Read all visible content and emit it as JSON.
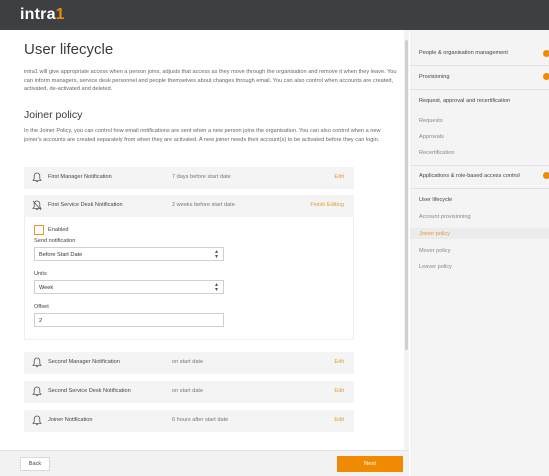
{
  "app": {
    "logo_main": "intra",
    "logo_accent": "1"
  },
  "page": {
    "title": "User lifecycle",
    "intro": "intra1 will give appropriate access when a person joins, adjusts that access as they move through the organisation and remove it when they leave. You can inform managers, service desk personnel and people themselves about changes through email. You can also control when accounts are created, activated, de-activated and deleted."
  },
  "section": {
    "title": "Joiner policy",
    "intro": "In the Joiner Policy, you can control how email notifications are sent when a new person joins the organisation. You can also control when a new joiner's accounts are created separately from when they are activated. A new joiner needs their account(s) to be activated before they can login."
  },
  "notifications": [
    {
      "title": "First Manager Notification",
      "timing": "7 days before start date",
      "action": "Edit"
    },
    {
      "title": "First Service Desk Notification",
      "timing": "2 weeks before start date",
      "action": "Finish Editing"
    },
    {
      "title": "Second Manager Notification",
      "timing": "on start date",
      "action": "Edit"
    },
    {
      "title": "Second Service Desk Notification",
      "timing": "on start date",
      "action": "Edit"
    },
    {
      "title": "Joiner Notification",
      "timing": "6 hours after start date",
      "action": "Edit"
    }
  ],
  "editor": {
    "enabled_label": "Enabled",
    "send_label": "Send notification",
    "send_value": "Before Start Date",
    "units_label": "Units",
    "units_value": "Week",
    "offset_label": "Offset",
    "offset_value": "2"
  },
  "sidebar": {
    "sections": [
      {
        "label": "People & organisation management"
      },
      {
        "label": "Provisioning"
      },
      {
        "label": "Request, approval and recertification"
      },
      {
        "label": "Requests"
      },
      {
        "label": "Approvals"
      },
      {
        "label": "Recertification"
      },
      {
        "label": "Applications & role-based access control"
      },
      {
        "label": "User lifecycle"
      },
      {
        "label": "Account provisioning"
      },
      {
        "label": "Joiner policy"
      },
      {
        "label": "Mover policy"
      },
      {
        "label": "Leaver policy"
      }
    ]
  },
  "footer": {
    "back": "Back",
    "next": "Next"
  },
  "colors": {
    "accent": "#f08a00",
    "topbar": "#3c4043"
  }
}
